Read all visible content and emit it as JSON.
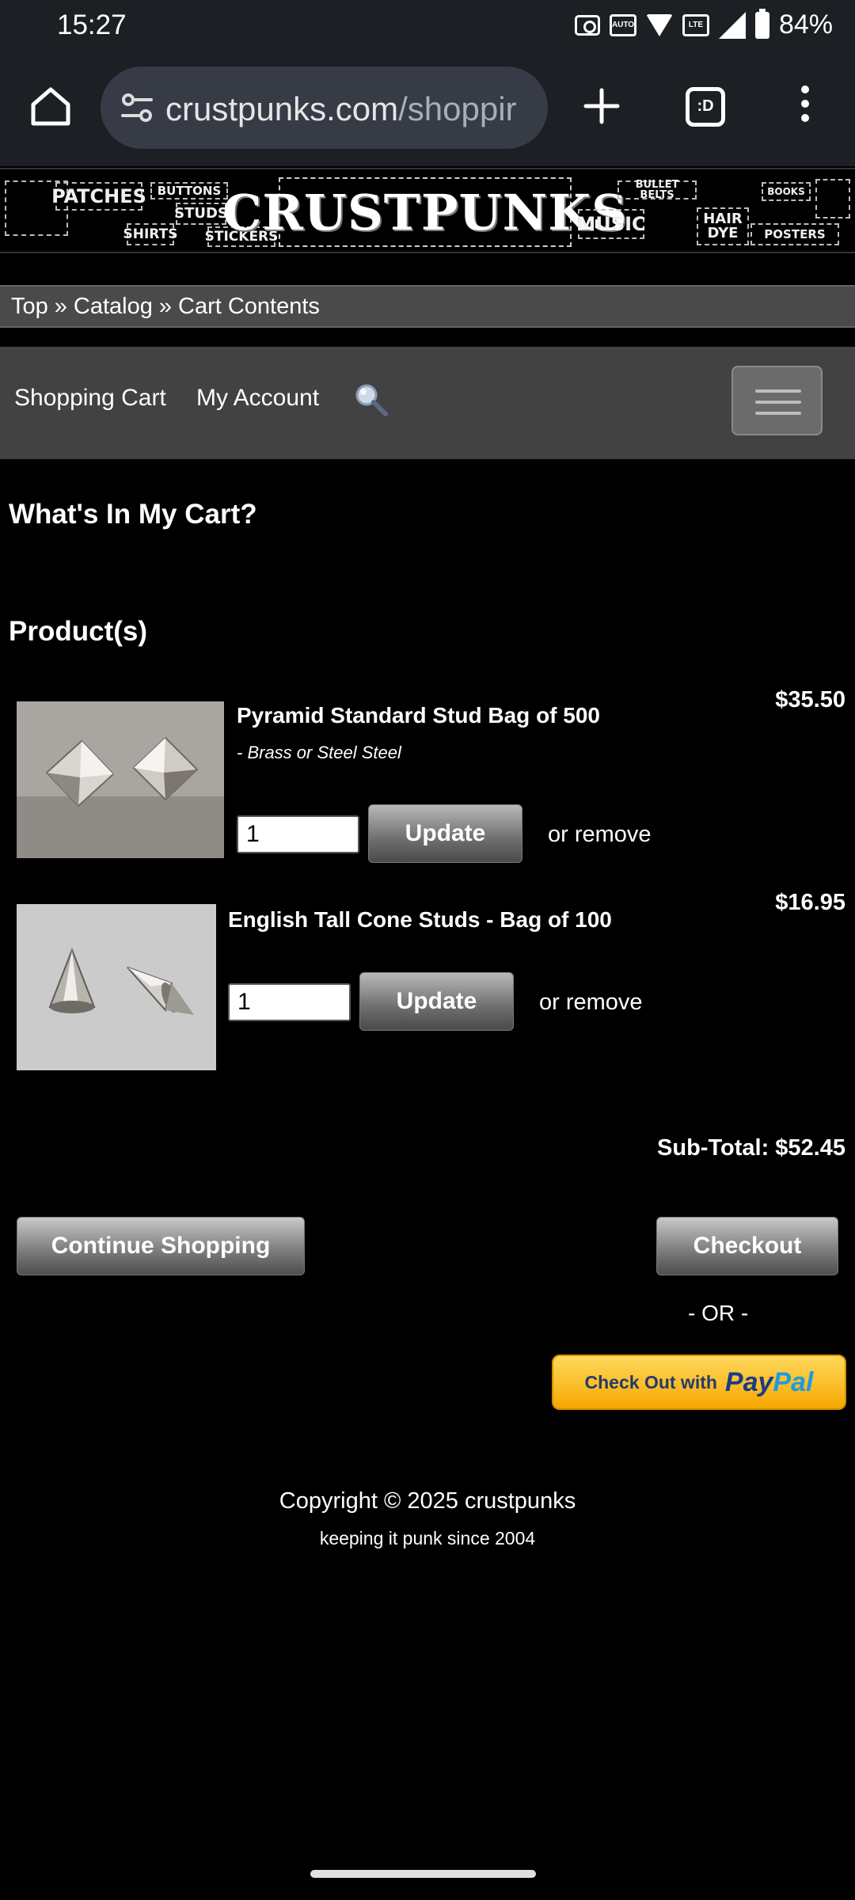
{
  "status_bar": {
    "time": "15:27",
    "battery": "84%",
    "icons": [
      "camera-icon",
      "auto-hz-icon",
      "wifi-icon",
      "volte-icon",
      "signal-icon",
      "battery-icon"
    ],
    "auto_label": "AUTO",
    "volte_label": "LTE"
  },
  "browser": {
    "url_main": "crustpunks.com",
    "url_rest": "/shoppir",
    "tab_count": ":D"
  },
  "banner": {
    "logo": "CRUSTPUNKS",
    "left_tiles": [
      "PATCHES",
      "BUTTONS",
      "STUDS",
      "SHIRTS",
      "STICKERS"
    ],
    "right_tiles": [
      "BULLET BELTS",
      "MUSIC",
      "HAIR DYE",
      "BOOKS",
      "POSTERS"
    ]
  },
  "breadcrumb": {
    "items": [
      "Top",
      "Catalog",
      "Cart Contents"
    ],
    "separator": "»"
  },
  "nav": {
    "shopping_cart": "Shopping Cart",
    "my_account": "My Account"
  },
  "page": {
    "title": "What's In My Cart?",
    "products_heading": "Product(s)"
  },
  "cart": {
    "items": [
      {
        "name": "Pyramid Standard Stud Bag of 500",
        "attribute": "- Brass or Steel Steel",
        "price": "$35.50",
        "qty": "1",
        "update_label": "Update",
        "remove_label": "or remove"
      },
      {
        "name": "English Tall Cone Studs - Bag of 100",
        "attribute": "",
        "price": "$16.95",
        "qty": "1",
        "update_label": "Update",
        "remove_label": "or remove"
      }
    ],
    "subtotal": "Sub-Total: $52.45",
    "continue_label": "Continue Shopping",
    "checkout_label": "Checkout",
    "or_label": "- OR -",
    "paypal_text": "Check Out with",
    "paypal_brand_a": "Pay",
    "paypal_brand_b": "Pal"
  },
  "footer": {
    "copyright": "Copyright © 2025 crustpunks",
    "tagline": "keeping it punk since 2004"
  },
  "colors": {
    "background": "#000000",
    "browser_chrome": "#1c1f24",
    "breadcrumb_bar": "#4a4a4a",
    "nav_bar": "#424242",
    "paypal_yellow": "#ffc439"
  }
}
